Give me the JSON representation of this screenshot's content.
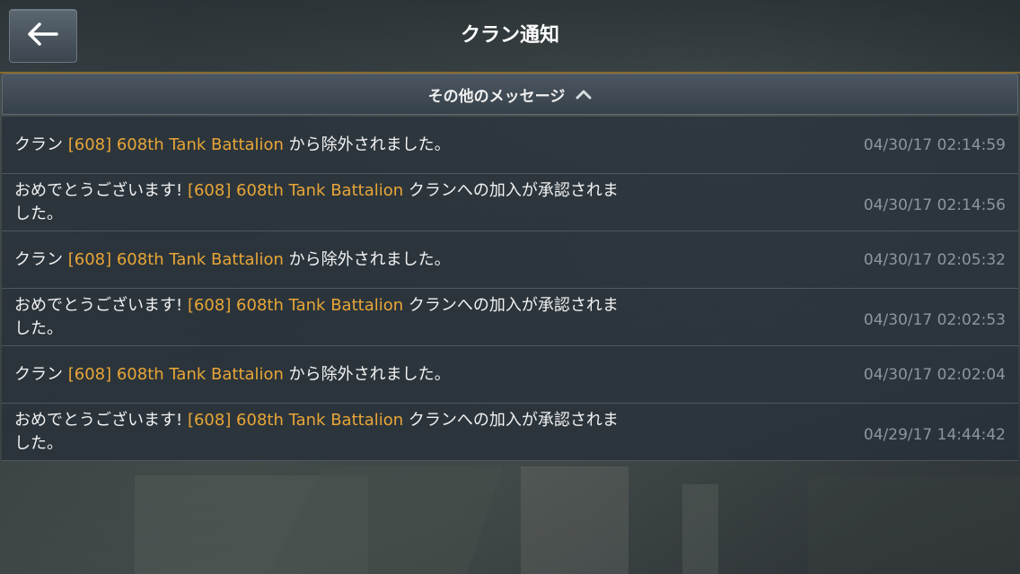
{
  "header": {
    "title": "クラン通知",
    "back_icon": "arrow-left-icon"
  },
  "section": {
    "label": "その他のメッセージ",
    "chevron_icon": "chevron-up-icon"
  },
  "colors": {
    "clan_name": "#e8a637",
    "timestamp": "#8d969d",
    "accent_line": "#8a6a2c"
  },
  "notifications": [
    {
      "prefix": "クラン ",
      "clan": "[608] 608th Tank Battalion",
      "suffix": " から除外されました。",
      "time": "04/30/17 02:14:59"
    },
    {
      "prefix": "おめでとうございます! ",
      "clan": "[608] 608th Tank Battalion",
      "suffix": " クランへの加入が承認されました。",
      "time": "04/30/17 02:14:56"
    },
    {
      "prefix": "クラン ",
      "clan": "[608] 608th Tank Battalion",
      "suffix": " から除外されました。",
      "time": "04/30/17 02:05:32"
    },
    {
      "prefix": "おめでとうございます! ",
      "clan": "[608] 608th Tank Battalion",
      "suffix": " クランへの加入が承認されました。",
      "time": "04/30/17 02:02:53"
    },
    {
      "prefix": "クラン ",
      "clan": "[608] 608th Tank Battalion",
      "suffix": " から除外されました。",
      "time": "04/30/17 02:02:04"
    },
    {
      "prefix": "おめでとうございます! ",
      "clan": "[608] 608th Tank Battalion",
      "suffix": " クランへの加入が承認されました。",
      "time": "04/29/17 14:44:42"
    }
  ]
}
